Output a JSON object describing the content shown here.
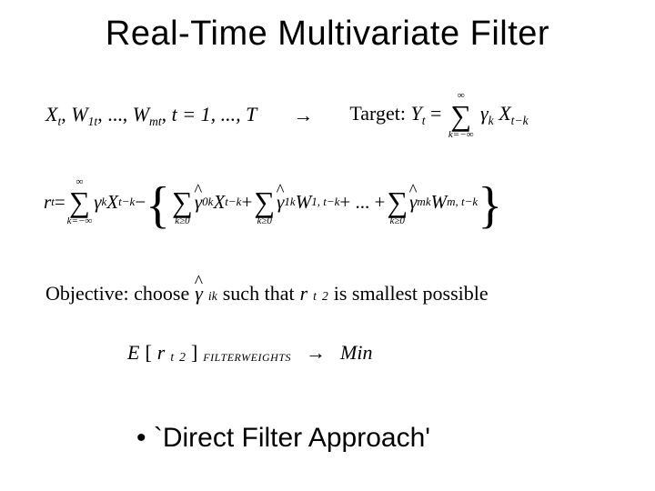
{
  "title": "Real-Time Multivariate Filter",
  "eq1": {
    "lhs_X": "X",
    "lhs_X_sub": "t",
    "comma1": ", ",
    "W1": "W",
    "W1_sub": "1t",
    "dots": ", ..., ",
    "Wm": "W",
    "Wm_sub": "mt",
    "comma2": ", ",
    "t_eq": "t = 1, ..., T",
    "arrow": "→",
    "target_label": "Target: ",
    "Y": "Y",
    "Y_sub": "t",
    "eq": " = ",
    "sum_top": "∞",
    "sum_bot": "k=−∞",
    "gamma": "γ",
    "gamma_sub": "k",
    "Xr": "X",
    "Xr_sub": "t−k"
  },
  "eq2": {
    "r": "r",
    "r_sub": "t",
    "eq": " = ",
    "sum1_top": "∞",
    "sum1_bot": "k=−∞",
    "g1": "γ",
    "g1_sub": "k",
    "X1": "X",
    "X1_sub": "t−k",
    "minus": " − ",
    "sum2_bot": "k≥0",
    "g0hat_sub": "0k",
    "X2": "X",
    "X2_sub": "t−k",
    "plus1": " + ",
    "g1hat_sub": "1k",
    "W1": "W",
    "W1_sub": "1, t−k",
    "plus2": " + ... + ",
    "gmhat_sub": "mk",
    "Wm": "W",
    "Wm_sub": "m, t−k"
  },
  "objective": {
    "prefix": "Objective: choose ",
    "ghat_sub": "ik",
    "middle": " such that ",
    "r": "r",
    "r_sub": "t",
    "r_sup": "2",
    "suffix": " is smallest possible"
  },
  "eq3": {
    "E": "E",
    "lb": "[",
    "r": "r",
    "r_sub": "t",
    "r_sup": "2",
    "rb": "]",
    "sub_label": "FILTERWEIGHTS",
    "arrow": "→",
    "Min": "Min"
  },
  "bullet": "`Direct Filter Approach'"
}
